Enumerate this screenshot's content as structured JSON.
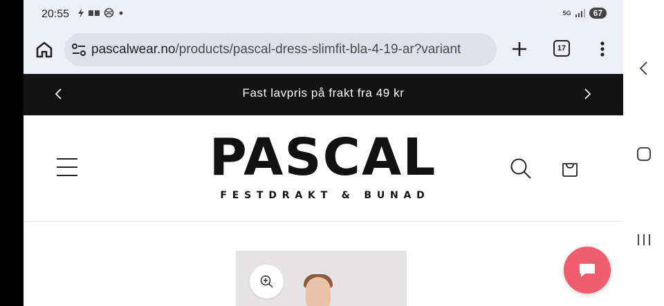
{
  "statusbar": {
    "time": "20:55",
    "network": "5G",
    "battery": "67"
  },
  "browser": {
    "url_host": "pascalwear.no",
    "url_path": "/products/pascal-dress-slimfit-bla-4-19-ar?variant",
    "tab_count": "17"
  },
  "announcement": {
    "text": "Fast lavpris på frakt fra 49 kr"
  },
  "header": {
    "logo_main": "PASCAL",
    "logo_sub": "FESTDRAKT & BUNAD"
  },
  "colors": {
    "announcement_bg": "#121212",
    "browser_chrome": "#eef0f6",
    "chat_button": "#ef5d6e"
  },
  "icons": [
    "home-icon",
    "site-settings-icon",
    "plus-icon",
    "tabs-icon",
    "more-vert-icon",
    "chevron-left-icon",
    "chevron-right-icon",
    "hamburger-icon",
    "search-icon",
    "cart-icon",
    "zoom-in-icon",
    "chat-icon",
    "back-nav-icon",
    "home-nav-icon",
    "recents-nav-icon"
  ]
}
